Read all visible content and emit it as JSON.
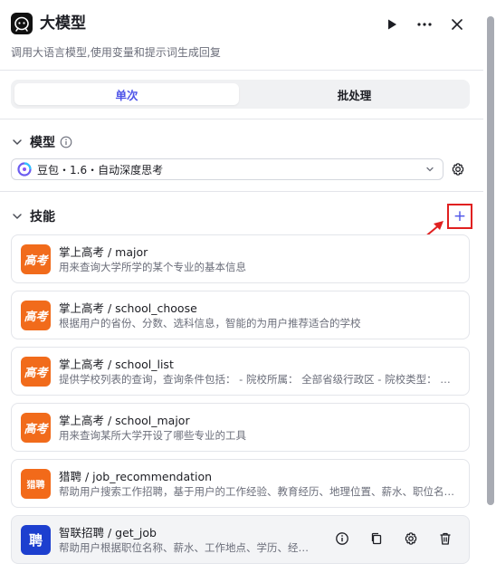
{
  "header": {
    "title": "大模型",
    "subtitle": "调用大语言模型,使用变量和提示词生成回复",
    "app_icon": "bot-icon",
    "run_icon": "play-icon",
    "more_icon": "more-icon",
    "close_icon": "close-icon"
  },
  "tabs": [
    {
      "label": "单次",
      "active": true
    },
    {
      "label": "批处理",
      "active": false
    }
  ],
  "model_section": {
    "title": "模型",
    "selected_model": "豆包・1.6・自动深度思考"
  },
  "skills_section": {
    "title": "技能",
    "add_label": "+",
    "items": [
      {
        "title": "掌上高考 / major",
        "desc": "用来查询大学所学的某个专业的基本信息",
        "icon_text": "高考"
      },
      {
        "title": "掌上高考 / school_choose",
        "desc": "根据用户的省份、分数、选科信息，智能的为用户推荐适合的学校",
        "icon_text": "高考"
      },
      {
        "title": "掌上高考 / school_list",
        "desc": "提供学校列表的查询，查询条件包括： - 院校所属： 全部省级行政区 - 院校类型： 综合、理工",
        "icon_text": "高考"
      },
      {
        "title": "掌上高考 / school_major",
        "desc": "用来查询某所大学开设了哪些专业的工具",
        "icon_text": "高考"
      },
      {
        "title": "猎聘 / job_recommendation",
        "desc": "帮助用户搜索工作招聘，基于用户的工作经验、教育经历、地理位置、薪水、职位名称等",
        "icon_text": "猎聘"
      },
      {
        "title": "智联招聘 / get_job",
        "desc": "帮助用户根据职位名称、薪水、工作地点、学历、经验等",
        "icon_text": "聘"
      }
    ]
  },
  "colors": {
    "accent": "#4d53e8",
    "highlight_border": "#e02020",
    "gaokao_orange": "#f16b1b",
    "zhilian_blue": "#1d3fcf"
  }
}
